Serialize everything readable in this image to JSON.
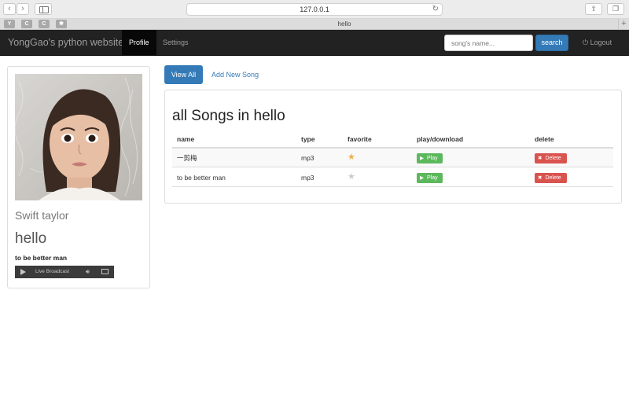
{
  "browser": {
    "url": "127.0.0.1",
    "tab_title": "hello",
    "favorites": [
      "Y",
      "C",
      "C"
    ]
  },
  "navbar": {
    "brand": "YongGao's python website",
    "links": [
      {
        "label": "Profile",
        "active": true
      },
      {
        "label": "Settings",
        "active": false
      }
    ],
    "search_placeholder": "song's name...",
    "search_button": "search",
    "logout": "Logout"
  },
  "album": {
    "artist": "Swift taylor",
    "title": "hello",
    "song": "to be better man",
    "player_label": "Live Broadcast"
  },
  "actions": {
    "view_all": "View All",
    "add_song": "Add New Song"
  },
  "songs": {
    "heading": "all Songs in hello",
    "columns": [
      "name",
      "type",
      "favorite",
      "play/download",
      "delete"
    ],
    "rows": [
      {
        "name": "一剪梅",
        "type": "mp3",
        "favorite": true
      },
      {
        "name": "to be better man",
        "type": "mp3",
        "favorite": false
      }
    ],
    "play_label": "Play",
    "delete_label": "Delete"
  },
  "colors": {
    "navbar": "#222222",
    "primary": "#337ab7",
    "success": "#5cb85c",
    "danger": "#d9534f",
    "star_on": "#f0ad4e",
    "star_off": "#cccccc"
  }
}
